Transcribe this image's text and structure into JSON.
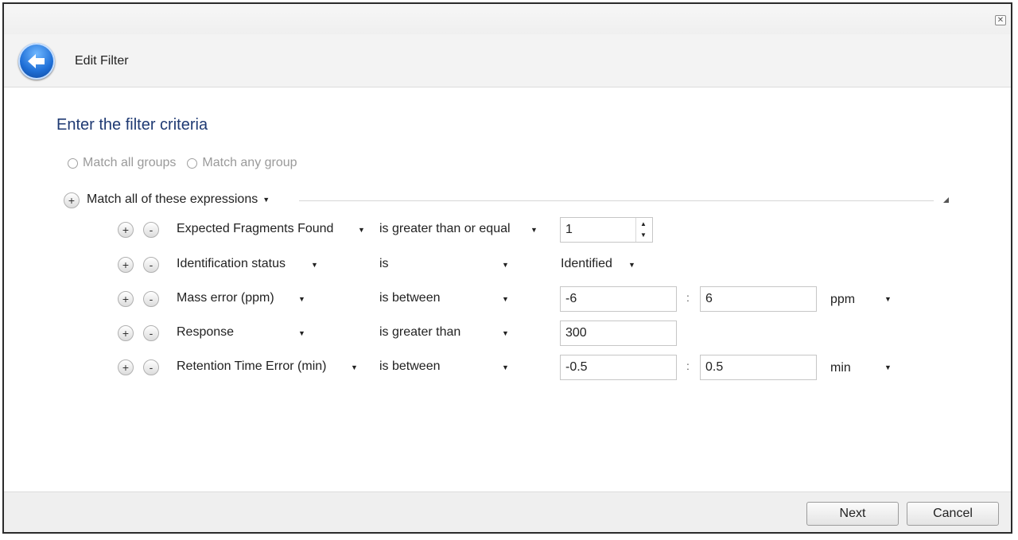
{
  "window": {
    "close_icon": "close-icon"
  },
  "header": {
    "title": "Edit Filter",
    "back_icon": "back-arrow-icon"
  },
  "main": {
    "heading": "Enter the filter criteria",
    "group_mode": {
      "options": [
        "Match all groups",
        "Match any group"
      ],
      "selected": null,
      "enabled": false
    },
    "group": {
      "label": "Match all of these expressions",
      "add": "+"
    },
    "row_buttons": {
      "add": "+",
      "remove": "-"
    },
    "conditions": [
      {
        "field": "Expected Fragments Found",
        "operator": "is greater than or equal",
        "value": "1"
      },
      {
        "field": "Identification status",
        "operator": "is",
        "value": "Identified"
      },
      {
        "field": "Mass error (ppm)",
        "operator": "is between",
        "value_min": "-6",
        "value_max": "6",
        "unit": "ppm"
      },
      {
        "field": "Response",
        "operator": "is greater than",
        "value": "300"
      },
      {
        "field": "Retention Time Error (min)",
        "operator": "is between",
        "value_min": "-0.5",
        "value_max": "0.5",
        "unit": "min"
      }
    ]
  },
  "footer": {
    "next_label": "Next",
    "cancel_label": "Cancel"
  },
  "colors": {
    "heading": "#1f3a73",
    "back_button": "#1f6fd6",
    "disabled_text": "#9a9a9a"
  }
}
